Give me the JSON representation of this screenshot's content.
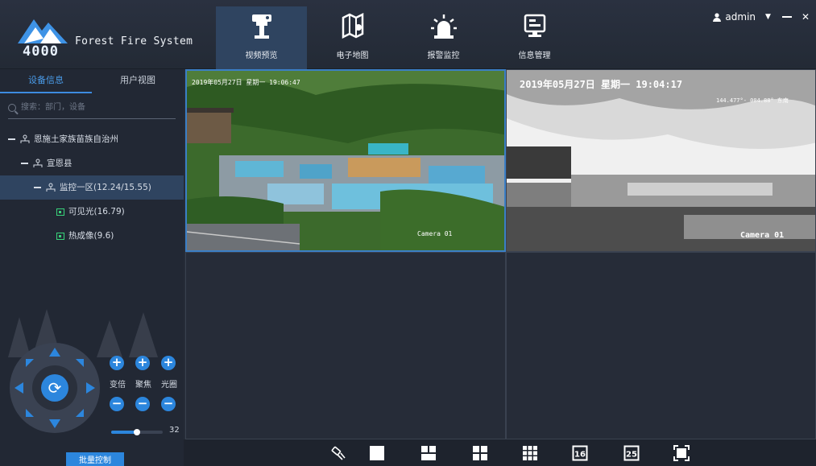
{
  "header": {
    "logo_number": "4000",
    "brand": "Forest Fire System",
    "nav": [
      {
        "label": "视频预览",
        "icon": "surveillance-camera-icon",
        "active": true
      },
      {
        "label": "电子地图",
        "icon": "map-icon",
        "active": false
      },
      {
        "label": "报警监控",
        "icon": "alarm-siren-icon",
        "active": false
      },
      {
        "label": "信息管理",
        "icon": "monitor-info-icon",
        "active": false
      }
    ],
    "user": "admin"
  },
  "sidebar": {
    "tabs": [
      {
        "label": "设备信息",
        "active": true
      },
      {
        "label": "用户视图",
        "active": false
      }
    ],
    "search_placeholder": "搜索：部门，设备",
    "tree": [
      {
        "label": "恩施土家族苗族自治州",
        "level": 0
      },
      {
        "label": "宣恩县",
        "level": 1
      },
      {
        "label": "监控一区(12.24/15.55)",
        "level": 2,
        "selected": true
      },
      {
        "label": "可见光(16.79)",
        "level": 3
      },
      {
        "label": "热成像(9.6)",
        "level": 3
      }
    ],
    "ptz": {
      "labels": [
        "变倍",
        "聚焦",
        "光圈"
      ],
      "speed": "32",
      "speed_fraction": 0.5
    },
    "batch_button": "批量控制"
  },
  "video": {
    "pane1": {
      "timestamp": "2019年05月27日 星期一 19:06:47",
      "camera": "Camera 01"
    },
    "pane2": {
      "timestamp": "2019年05月27日 星期一 19:04:17",
      "ptz_info": "144.477°- 004.88° 东南",
      "camera": "Camera 01"
    }
  },
  "colors": {
    "accent": "#2c86dd",
    "active_nav": "#2f4460",
    "camera_green": "#38d37a"
  }
}
